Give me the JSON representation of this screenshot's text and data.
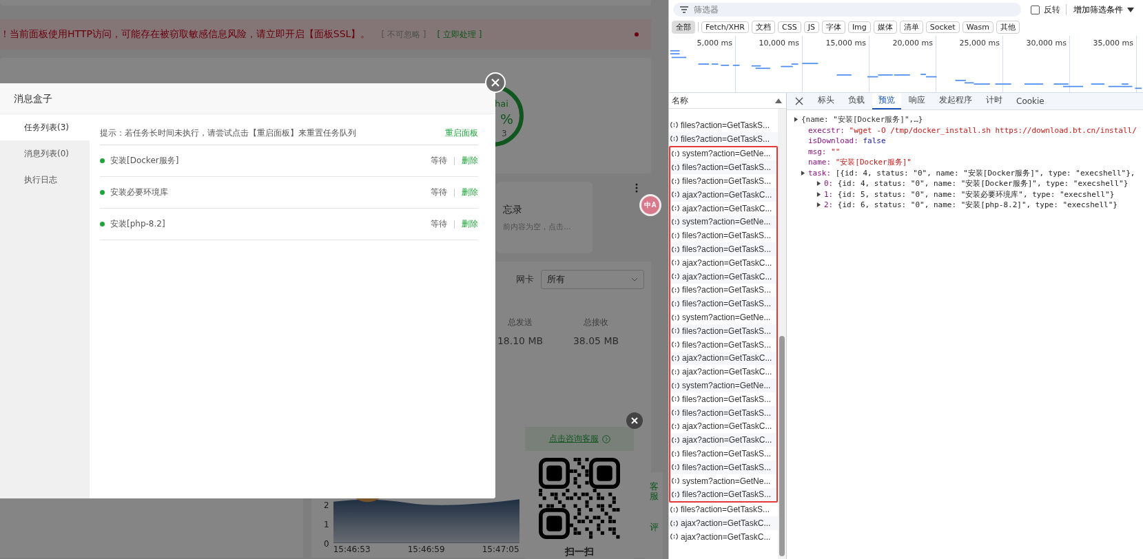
{
  "page": {
    "warning": {
      "message": "！当前面板使用HTTP访问，可能存在被窃取敏感信息风险，请立即开启【面板SSL】。",
      "ignore": "[ 不可忽略 ]",
      "action": "[ 立即处理 ]"
    },
    "gauge_fragments": [
      "hai",
      "%",
      "3"
    ],
    "memo": {
      "title": "忘录",
      "text": "前内容为空，点击..."
    },
    "translate_badge": "中A",
    "network": {
      "nic_label": "网卡",
      "nic_value": "所有",
      "stats": [
        {
          "label": "总发送",
          "value": "18.10 MB"
        },
        {
          "label": "总接收",
          "value": "38.05 MB"
        }
      ],
      "chart": {
        "y_labels": [
          "2",
          "1",
          "0"
        ],
        "x_labels": [
          "15:46:53",
          "15:46:59",
          "15:47:05"
        ]
      }
    },
    "support": {
      "link": "点击咨询客服",
      "scan": "扫一扫",
      "side_tabs": [
        "客服",
        "评"
      ]
    }
  },
  "modal": {
    "title": "消息盒子",
    "menu": [
      {
        "label": "任务列表(3)",
        "selected": true
      },
      {
        "label": "消息列表(0)",
        "selected": false
      },
      {
        "label": "执行日志",
        "selected": false
      }
    ],
    "hint": "提示：若任务长时间未执行，请尝试点击【重启面板】来重置任务队列",
    "restart": "重启面板",
    "tasks": [
      {
        "name": "安装[Docker服务]",
        "status": "等待",
        "action": "删除"
      },
      {
        "name": "安装必要环境库",
        "status": "等待",
        "action": "删除"
      },
      {
        "name": "安装[php-8.2]",
        "status": "等待",
        "action": "删除"
      }
    ]
  },
  "devtools": {
    "filter": {
      "placeholder": "筛选器"
    },
    "invert": {
      "label": "反转",
      "checked": false
    },
    "more_filters": "增加筛选条件",
    "types": [
      {
        "label": "全部",
        "selected": true
      },
      {
        "label": "Fetch/XHR",
        "selected": false
      },
      {
        "label": "文档",
        "selected": false
      },
      {
        "label": "CSS",
        "selected": false
      },
      {
        "label": "JS",
        "selected": false
      },
      {
        "label": "字体",
        "selected": false
      },
      {
        "label": "Img",
        "selected": false
      },
      {
        "label": "媒体",
        "selected": false
      },
      {
        "label": "清单",
        "selected": false
      },
      {
        "label": "Socket",
        "selected": false
      },
      {
        "label": "Wasm",
        "selected": false
      },
      {
        "label": "其他",
        "selected": false
      }
    ],
    "overview_ticks": [
      "5,000 ms",
      "10,000 ms",
      "15,000 ms",
      "20,000 ms",
      "25,000 ms",
      "30,000 ms",
      "35,000 ms"
    ],
    "list": {
      "header": "名称",
      "rows_before": [
        "files?action=GetTaskS...",
        "files?action=GetTaskS..."
      ],
      "highlighted_rows": [
        "system?action=GetNe...",
        "files?action=GetTaskS...",
        "files?action=GetTaskS...",
        "ajax?action=GetTaskC...",
        "ajax?action=GetTaskC...",
        "system?action=GetNe...",
        "files?action=GetTaskS...",
        "files?action=GetTaskS...",
        "ajax?action=GetTaskC...",
        "ajax?action=GetTaskC...",
        "files?action=GetTaskS...",
        "files?action=GetTaskS...",
        "system?action=GetNe...",
        "files?action=GetTaskS...",
        "files?action=GetTaskS...",
        "ajax?action=GetTaskC...",
        "ajax?action=GetTaskC...",
        "system?action=GetNe...",
        "files?action=GetTaskS...",
        "files?action=GetTaskS...",
        "ajax?action=GetTaskC...",
        "ajax?action=GetTaskC...",
        "files?action=GetTaskS...",
        "files?action=GetTaskS...",
        "system?action=GetNe...",
        "files?action=GetTaskS..."
      ],
      "rows_after": [
        "files?action=GetTaskS...",
        "ajax?action=GetTaskC...",
        "ajax?action=GetTaskC..."
      ]
    },
    "detail_tabs": [
      {
        "label": "标头",
        "selected": false
      },
      {
        "label": "负载",
        "selected": false
      },
      {
        "label": "预览",
        "selected": true
      },
      {
        "label": "响应",
        "selected": false
      },
      {
        "label": "发起程序",
        "selected": false
      },
      {
        "label": "计时",
        "selected": false
      },
      {
        "label": "Cookie",
        "selected": false
      }
    ],
    "preview": {
      "summary": "{name: \"安装[Docker服务]\",…}",
      "expanded": false,
      "fields": [
        {
          "key": "execstr:",
          "value": "\"wget -O /tmp/docker_install.sh https://download.bt.cn/install/",
          "kind": "string"
        },
        {
          "key": "isDownload:",
          "value": "false",
          "kind": "keyword"
        },
        {
          "key": "msg:",
          "value": "\"\"",
          "kind": "string"
        },
        {
          "key": "name:",
          "value": "\"安装[Docker服务]\"",
          "kind": "string"
        },
        {
          "key": "task:",
          "value": "[{id: 4, status: \"0\", name: \"安装[Docker服务]\", type: \"execshell\"},",
          "kind": "object",
          "expanded": false,
          "children": [
            {
              "key": "0:",
              "value": "{id: 4, status: \"0\", name: \"安装[Docker服务]\", type: \"execshell\"}",
              "kind": "object",
              "expanded": false
            },
            {
              "key": "1:",
              "value": "{id: 5, status: \"0\", name: \"安装必要环境库\", type: \"execshell\"}",
              "kind": "object",
              "expanded": false
            },
            {
              "key": "2:",
              "value": "{id: 6, status: \"0\", name: \"安装[php-8.2]\", type: \"execshell\"}",
              "kind": "object",
              "expanded": false
            }
          ]
        }
      ]
    }
  }
}
